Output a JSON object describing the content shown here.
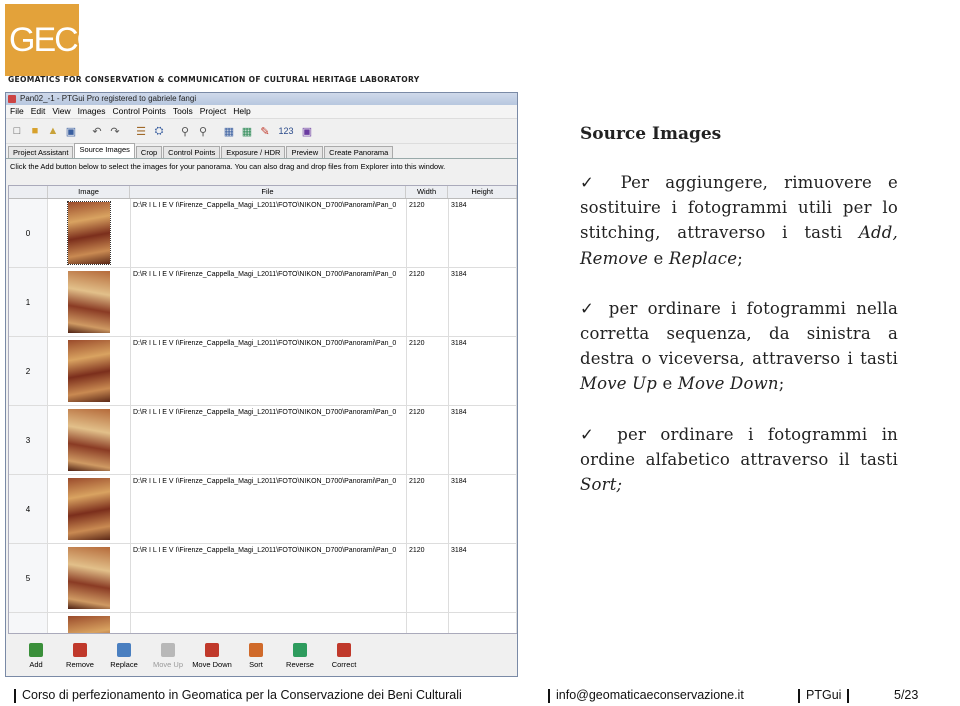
{
  "logo": {
    "text": "GECO",
    "color": "#e3a23a"
  },
  "lab_title": "GEOMATICS FOR CONSERVATION & COMMUNICATION OF CULTURAL HERITAGE LABORATORY",
  "window": {
    "title": "Pan02_-1 - PTGui Pro registered to gabriele fangi",
    "menu": [
      "File",
      "Edit",
      "View",
      "Images",
      "Control Points",
      "Tools",
      "Project",
      "Help"
    ],
    "toolbar_number": "123",
    "tabs": [
      "Project Assistant",
      "Source Images",
      "Crop",
      "Control Points",
      "Exposure / HDR",
      "Preview",
      "Create Panorama"
    ],
    "active_tab": "Source Images",
    "hint": "Click the Add button below to select the images for your panorama. You can also drag and drop files from Explorer into this window.",
    "columns": [
      "Image",
      "File",
      "Width",
      "Height"
    ],
    "rows": [
      {
        "index": "0",
        "file": "D:\\R I L I E V I\\Firenze_Cappella_Magi_L2011\\FOTO\\NIKON_D700\\Panorami\\Pan_0",
        "width": "2120",
        "height": "3184"
      },
      {
        "index": "1",
        "file": "D:\\R I L I E V I\\Firenze_Cappella_Magi_L2011\\FOTO\\NIKON_D700\\Panorami\\Pan_0",
        "width": "2120",
        "height": "3184"
      },
      {
        "index": "2",
        "file": "D:\\R I L I E V I\\Firenze_Cappella_Magi_L2011\\FOTO\\NIKON_D700\\Panorami\\Pan_0",
        "width": "2120",
        "height": "3184"
      },
      {
        "index": "3",
        "file": "D:\\R I L I E V I\\Firenze_Cappella_Magi_L2011\\FOTO\\NIKON_D700\\Panorami\\Pan_0",
        "width": "2120",
        "height": "3184"
      },
      {
        "index": "4",
        "file": "D:\\R I L I E V I\\Firenze_Cappella_Magi_L2011\\FOTO\\NIKON_D700\\Panorami\\Pan_0",
        "width": "2120",
        "height": "3184"
      },
      {
        "index": "5",
        "file": "D:\\R I L I E V I\\Firenze_Cappella_Magi_L2011\\FOTO\\NIKON_D700\\Panorami\\Pan_0",
        "width": "2120",
        "height": "3184"
      },
      {
        "index": "",
        "file": "",
        "width": "",
        "height": ""
      }
    ],
    "buttons": [
      {
        "label": "Add",
        "color": "#3a8f3a",
        "enabled": true
      },
      {
        "label": "Remove",
        "color": "#c0392b",
        "enabled": true
      },
      {
        "label": "Replace",
        "color": "#4a7fc0",
        "enabled": true
      },
      {
        "label": "Move Up",
        "color": "#b8b8b8",
        "enabled": false
      },
      {
        "label": "Move Down",
        "color": "#c0392b",
        "enabled": true
      },
      {
        "label": "Sort",
        "color": "#d06a2a",
        "enabled": true
      },
      {
        "label": "Reverse",
        "color": "#2e9c5e",
        "enabled": true
      },
      {
        "label": "Correct",
        "color": "#c0392b",
        "enabled": true
      }
    ]
  },
  "right": {
    "heading": "Source Images",
    "p1_a": "Per aggiungere, rimuovere e sostituire i fotogrammi utili per lo stitching, attraverso i tasti ",
    "p1_i": "Add, Remove",
    "p1_b": " e ",
    "p1_i2": "Replace",
    "p1_c": ";",
    "p2_a": "per ordinare i fotogrammi nella corretta sequenza, da sinistra a destra o viceversa, attraverso i tasti ",
    "p2_i": "Move Up",
    "p2_b": " e ",
    "p2_i2": "Move Down",
    "p2_c": ";",
    "p3_a": "per ordinare i fotogrammi in ordine alfabetico attraverso il tasti ",
    "p3_i": "Sort;"
  },
  "footer": {
    "course": "Corso di perfezionamento in Geomatica per la Conservazione dei Beni Culturali",
    "email": "info@geomaticaeconservazione.it",
    "section": "PTGui",
    "page": "5/23"
  }
}
